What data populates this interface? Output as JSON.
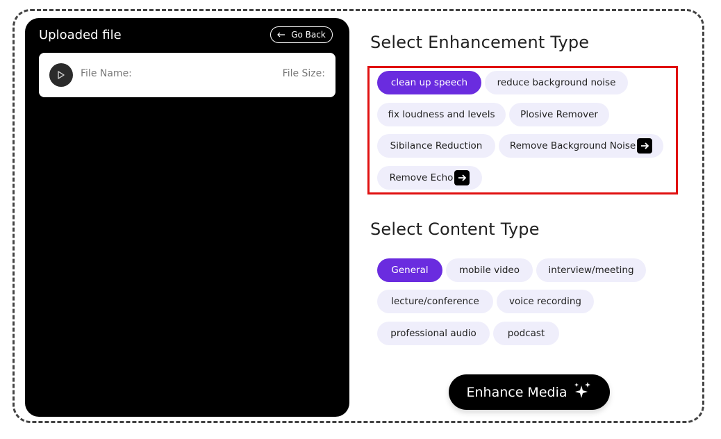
{
  "left_panel": {
    "title": "Uploaded file",
    "go_back_label": "Go Back",
    "file_name_label": "File Name:",
    "file_size_label": "File Size:"
  },
  "enhancement": {
    "title": "Select Enhancement Type",
    "options": [
      {
        "label": "clean up speech",
        "selected": true
      },
      {
        "label": "reduce background noise"
      },
      {
        "label": "fix loudness and levels"
      },
      {
        "label": "Plosive Remover"
      },
      {
        "label": "Sibilance Reduction"
      },
      {
        "label": "Remove Background Noise",
        "icon": "arrow-right-icon"
      },
      {
        "label": "Remove Echo",
        "icon": "arrow-right-icon"
      }
    ]
  },
  "content": {
    "title": "Select Content Type",
    "options": [
      {
        "label": "General",
        "selected": true
      },
      {
        "label": "mobile video"
      },
      {
        "label": "interview/meeting"
      },
      {
        "label": "lecture/conference"
      },
      {
        "label": "voice recording"
      },
      {
        "label": "professional audio"
      },
      {
        "label": "podcast"
      }
    ]
  },
  "enhance_button": {
    "label": "Enhance Media",
    "icon": "sparkles-icon"
  },
  "colors": {
    "accent": "#6a2cdf",
    "chip_bg": "#efeefb",
    "highlight": "#e01010"
  }
}
